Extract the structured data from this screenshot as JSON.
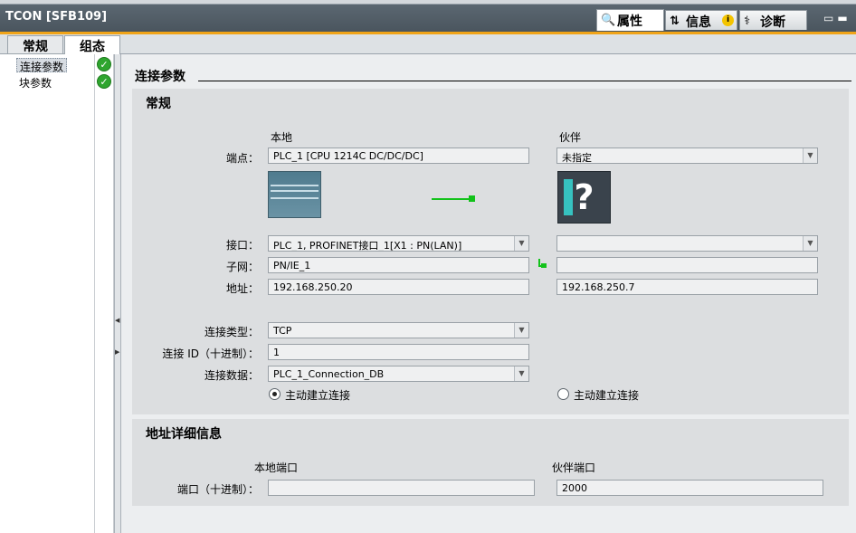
{
  "window": {
    "title": "TCON [SFB109]"
  },
  "inspector_tabs": [
    {
      "label": "属性",
      "icon": "properties-icon"
    },
    {
      "label": "信息",
      "icon": "info-icon"
    },
    {
      "label": "诊断",
      "icon": "diagnostics-icon"
    }
  ],
  "tabs": [
    {
      "label": "常规"
    },
    {
      "label": "组态"
    }
  ],
  "nav": {
    "items": [
      {
        "label": "连接参数",
        "status": "ok"
      },
      {
        "label": "块参数",
        "status": "ok"
      }
    ]
  },
  "section_title": "连接参数",
  "general": {
    "title": "常规",
    "col_local": "本地",
    "col_partner": "伙伴",
    "labels": {
      "endpoint": "端点：",
      "interface": "接口：",
      "subnet": "子网：",
      "address": "地址：",
      "conn_type": "连接类型：",
      "conn_id": "连接 ID（十进制）：",
      "conn_data": "连接数据："
    },
    "local": {
      "endpoint": "PLC_1 [CPU 1214C DC/DC/DC]",
      "interface": "PLC_1, PROFINET接口_1[X1 : PN(LAN)]",
      "subnet": "PN/IE_1",
      "address": "192.168.250.20"
    },
    "partner": {
      "endpoint": "未指定",
      "interface": "",
      "subnet": "",
      "address": "192.168.250.7"
    },
    "conn_type": "TCP",
    "conn_id": "1",
    "conn_data": "PLC_1_Connection_DB",
    "local_active_label": "主动建立连接",
    "partner_active_label": "主动建立连接",
    "local_active": true,
    "partner_active": false
  },
  "address_details": {
    "title": "地址详细信息",
    "col_local_port": "本地端口",
    "col_partner_port": "伙伴端口",
    "port_label": "端口（十进制）：",
    "local_port": "",
    "partner_port": "2000"
  },
  "colors": {
    "accent": "#f0a418",
    "connection": "#12c21a",
    "ok": "#2fa52f"
  }
}
